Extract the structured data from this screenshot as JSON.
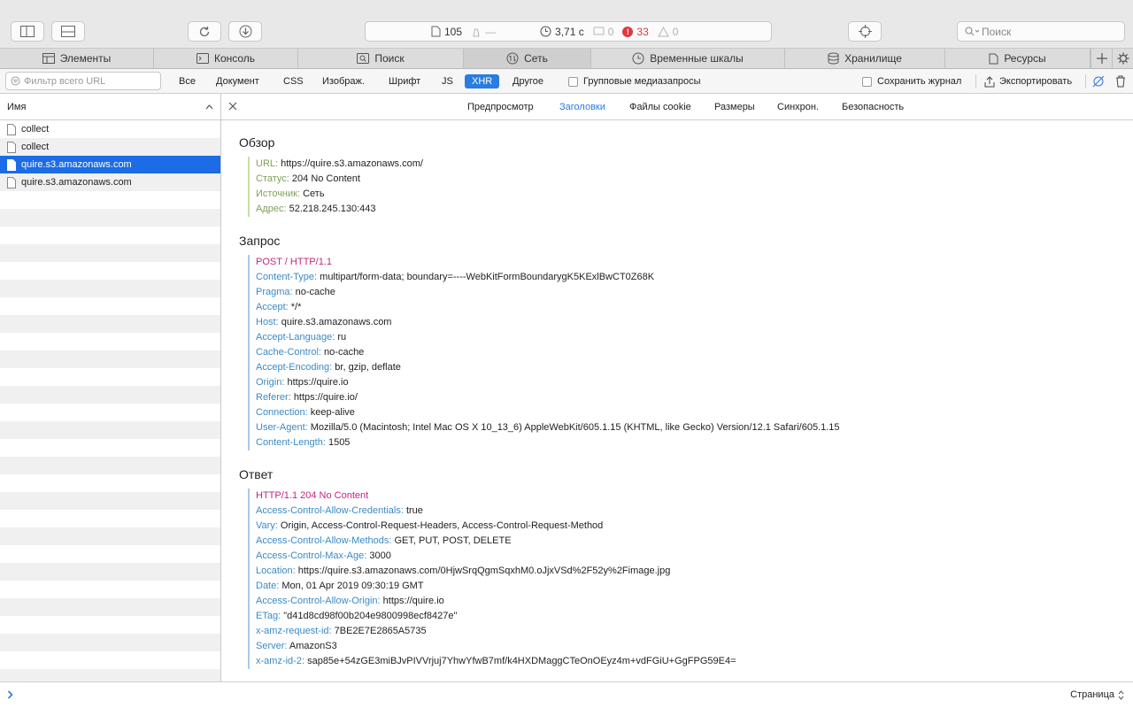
{
  "status": {
    "resources": "105",
    "size": "—",
    "time": "3,71 с",
    "messages": "0",
    "errors": "33",
    "warnings": "0"
  },
  "search": {
    "placeholder": "Поиск"
  },
  "tabs": [
    {
      "label": "Элементы",
      "icon": "elements-icon"
    },
    {
      "label": "Консоль",
      "icon": "console-icon"
    },
    {
      "label": "Поиск",
      "icon": "search-icon"
    },
    {
      "label": "Сеть",
      "icon": "network-icon",
      "active": true
    },
    {
      "label": "Временные шкалы",
      "icon": "clock-icon"
    },
    {
      "label": "Хранилище",
      "icon": "storage-icon"
    },
    {
      "label": "Ресурсы",
      "icon": "document-icon"
    }
  ],
  "filter": {
    "placeholder": "Фильтр всего URL",
    "types": [
      "Все",
      "Документ",
      "CSS",
      "Изображ.",
      "Шрифт",
      "JS",
      "XHR",
      "Другое"
    ],
    "active_type": "XHR",
    "group_media": "Групповые медиазапросы",
    "preserve_log": "Сохранить журнал",
    "export": "Экспортировать"
  },
  "list": {
    "header": "Имя",
    "items": [
      "collect",
      "collect",
      "quire.s3.amazonaws.com",
      "quire.s3.amazonaws.com"
    ],
    "selected_index": 2
  },
  "detail_tabs": {
    "items": [
      "Предпросмотр",
      "Заголовки",
      "Файлы cookie",
      "Размеры",
      "Синхрон.",
      "Безопасность"
    ],
    "active": "Заголовки"
  },
  "overview": {
    "title": "Обзор",
    "rows": [
      {
        "k": "URL:",
        "v": "https://quire.s3.amazonaws.com/"
      },
      {
        "k": "Статус:",
        "v": "204 No Content"
      },
      {
        "k": "Источник:",
        "v": "Сеть"
      },
      {
        "k": "Адрес:",
        "v": "52.218.245.130:443"
      }
    ]
  },
  "request": {
    "title": "Запрос",
    "first_line": "POST / HTTP/1.1",
    "rows": [
      {
        "k": "Content-Type:",
        "v": "multipart/form-data; boundary=----WebKitFormBoundarygK5KExlBwCT0Z68K"
      },
      {
        "k": "Pragma:",
        "v": "no-cache"
      },
      {
        "k": "Accept:",
        "v": "*/*"
      },
      {
        "k": "Host:",
        "v": "quire.s3.amazonaws.com"
      },
      {
        "k": "Accept-Language:",
        "v": "ru"
      },
      {
        "k": "Cache-Control:",
        "v": "no-cache"
      },
      {
        "k": "Accept-Encoding:",
        "v": "br, gzip, deflate"
      },
      {
        "k": "Origin:",
        "v": "https://quire.io"
      },
      {
        "k": "Referer:",
        "v": "https://quire.io/"
      },
      {
        "k": "Connection:",
        "v": "keep-alive"
      },
      {
        "k": "User-Agent:",
        "v": "Mozilla/5.0 (Macintosh; Intel Mac OS X 10_13_6) AppleWebKit/605.1.15 (KHTML, like Gecko) Version/12.1 Safari/605.1.15"
      },
      {
        "k": "Content-Length:",
        "v": "1505"
      }
    ]
  },
  "response": {
    "title": "Ответ",
    "first_line": "HTTP/1.1 204 No Content",
    "rows": [
      {
        "k": "Access-Control-Allow-Credentials:",
        "v": "true"
      },
      {
        "k": "Vary:",
        "v": "Origin, Access-Control-Request-Headers, Access-Control-Request-Method"
      },
      {
        "k": "Access-Control-Allow-Methods:",
        "v": "GET, PUT, POST, DELETE"
      },
      {
        "k": "Access-Control-Max-Age:",
        "v": "3000"
      },
      {
        "k": "Location:",
        "v": "https://quire.s3.amazonaws.com/0HjwSrqQgmSqxhM0.oJjxVSd%2F52y%2Fimage.jpg"
      },
      {
        "k": "Date:",
        "v": "Mon, 01 Apr 2019 09:30:19 GMT"
      },
      {
        "k": "Access-Control-Allow-Origin:",
        "v": "https://quire.io"
      },
      {
        "k": "ETag:",
        "v": "\"d41d8cd98f00b204e9800998ecf8427e\""
      },
      {
        "k": "x-amz-request-id:",
        "v": "7BE2E7E2865A5735"
      },
      {
        "k": "Server:",
        "v": "AmazonS3"
      },
      {
        "k": "x-amz-id-2:",
        "v": "sap85e+54zGE3miBJvPIVVrjuj7YhwYfwB7mf/k4HXDMaggCTeOnOEyz4m+vdFGiU+GgFPG59E4="
      }
    ]
  },
  "bottom": {
    "page_label": "Страница"
  },
  "colors": {
    "accent": "#2a7ce0",
    "selection": "#1c6ce6",
    "overview_key": "#7ea257",
    "header_key": "#3a8ac6",
    "first_line": "#c2277f",
    "error": "#e0383e"
  }
}
